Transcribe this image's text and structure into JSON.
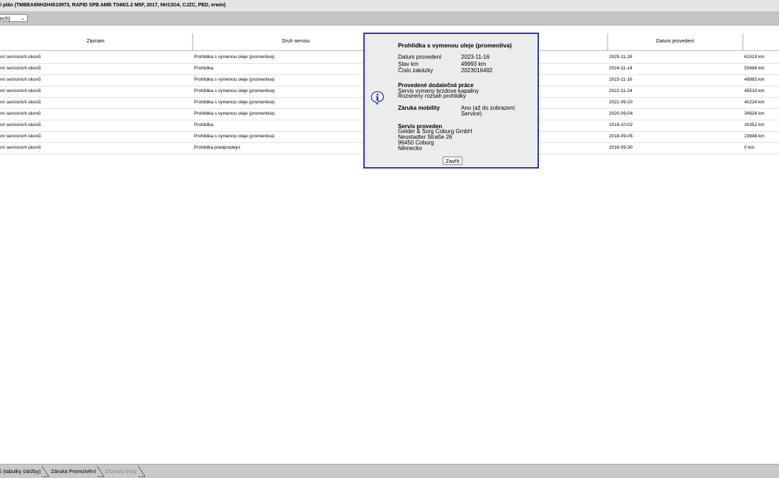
{
  "window": {
    "title": "ní plán (TMBEA6NH2H4510973, RAPID SPB AMB TS66/1.2 M5F, 2017, NH13G4, CJZC, PED, erwin)"
  },
  "toolbar": {
    "select_value": "ech)"
  },
  "table": {
    "columns": [
      "Záznam",
      "Druh servisu",
      "",
      "Datum provedení",
      ""
    ],
    "rows": [
      {
        "zaznam": "ení servisních úkonů",
        "druh": "Prohlidka s vymenou oleje (promenliva)",
        "datum": "2025-11-28",
        "km": "61519 km"
      },
      {
        "zaznam": "ení servisních úkonů",
        "druh": "Prohlidka",
        "datum": "2024-11-14",
        "km": "55486 km"
      },
      {
        "zaznam": "ení servisních úkonů",
        "druh": "Prohlidka s vymenou oleje (promenliva)",
        "datum": "2023-11-16",
        "km": "49993 km"
      },
      {
        "zaznam": "ení servisních úkonů",
        "druh": "Prohlidka s vymenou oleje (promenliva)",
        "datum": "2022-11-24",
        "km": "45533 km"
      },
      {
        "zaznam": "ení servisních úkonů",
        "druh": "Prohlidka s vymenou oleje (promenliva)",
        "datum": "2021-09-20",
        "km": "40224 km"
      },
      {
        "zaznam": "ení servisních úkonů",
        "druh": "Prohlidka s vymenou oleje (promenliva)",
        "datum": "2020-09-04",
        "km": "34926 km"
      },
      {
        "zaznam": "ení servisních úkonů",
        "druh": "Prohlidka",
        "datum": "2019-10-02",
        "km": "30352 km"
      },
      {
        "zaznam": "ení servisních úkonů",
        "druh": "Prohlidka s vymenou oleje (promenliva)",
        "datum": "2018-09-05",
        "km": "23948 km"
      },
      {
        "zaznam": "ení servisních úkonů",
        "druh": "Prohlidka predprodejni",
        "datum": "2016-09-30",
        "km": "0 km"
      }
    ]
  },
  "dialog": {
    "title": "Prohlidka s vymenou oleje (promenliva)",
    "fields": [
      {
        "label": "Datum provedení",
        "value": "2023-11-16"
      },
      {
        "label": "Stav km",
        "value": "49993 km"
      },
      {
        "label": "Číslo zakázky",
        "value": "2023016492"
      }
    ],
    "extra_work_heading": "Provedené dodatečné práce",
    "extra_work": [
      "Servis vymeny brzdove kapaliny",
      "Rozsireny rozsah prohlidky"
    ],
    "mobility_label": "Záruka mobility",
    "mobility_value_1": "Ano (až do zobrazení",
    "mobility_value_2": "Service)",
    "service_heading": "Servis proveden",
    "service_lines": [
      "Gelder & Sorg Coburg GmbH",
      "Neustadter Straße 26",
      "96450 Coburg",
      "Německo"
    ],
    "close_label": "Zavřít"
  },
  "tabs": [
    {
      "label": "Š (tabulky údržby)",
      "disabled": false
    },
    {
      "label": "Záruka Prorezivění",
      "disabled": false
    },
    {
      "label": "Záznam dílny",
      "disabled": true
    }
  ],
  "colors": {
    "dialog_border": "#2d33cc",
    "toolbar_bg": "#c4c4c4",
    "info_icon": "#2d33cc"
  }
}
